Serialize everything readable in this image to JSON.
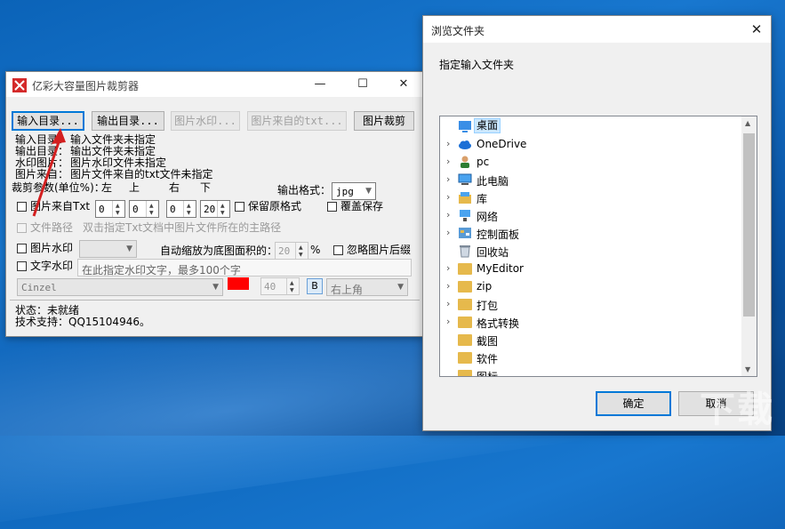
{
  "app": {
    "title": "亿彩大容量图片裁剪器",
    "buttons": {
      "input_dir": "输入目录...",
      "output_dir": "输出目录...",
      "watermark_img": "图片水印...",
      "txt_source": "图片来自的txt...",
      "crop": "图片裁剪"
    },
    "info": {
      "input_label": "输入目录：",
      "input_value": "输入文件夹未指定",
      "output_label": "输出目录：",
      "output_value": "输出文件夹未指定",
      "watermark_label": "水印图片：",
      "watermark_value": "图片水印文件未指定",
      "source_label": "图片来自：",
      "source_value": "图片文件来自的txt文件未指定"
    },
    "crop": {
      "params_label": "裁剪参数(单位%)：",
      "left": "左",
      "top": "上",
      "right": "右",
      "bottom": "下",
      "left_value": "0",
      "top_value": "0",
      "right_value": "0",
      "bottom_value": "20"
    },
    "output_format_label": "输出格式：",
    "output_format_value": "jpg",
    "from_txt_label": "图片来自Txt",
    "keep_format_label": "保留原格式",
    "overwrite_label": "覆盖保存",
    "file_path_label": "文件路径",
    "file_path_hint": "双击指定Txt文档中图片文件所在的主路径",
    "img_watermark_label": "图片水印",
    "auto_scale_label": "自动缩放为底图面积的：",
    "auto_scale_value": "20",
    "auto_scale_unit": "%",
    "ignore_after_label": "忽略图片后缀",
    "text_watermark_label": "文字水印",
    "text_watermark_placeholder": "在此指定水印文字，最多100个字",
    "font_value": "Cinzel",
    "font_color": "#ff0000",
    "font_size_value": "40",
    "bold_label": "B",
    "position_value": "右上角",
    "status_label": "状态：",
    "status_value": "未就绪",
    "support_label": "技术支持：",
    "support_value": "QQ15104946。"
  },
  "dialog": {
    "title": "浏览文件夹",
    "prompt": "指定输入文件夹",
    "items": [
      {
        "label": "桌面",
        "icon": "desktop-icon"
      },
      {
        "label": "OneDrive",
        "icon": "cloud-icon"
      },
      {
        "label": "pc",
        "icon": "user-icon"
      },
      {
        "label": "此电脑",
        "icon": "computer-icon"
      },
      {
        "label": "库",
        "icon": "library-icon"
      },
      {
        "label": "网络",
        "icon": "network-icon"
      },
      {
        "label": "控制面板",
        "icon": "control-panel-icon"
      },
      {
        "label": "回收站",
        "icon": "recycle-bin-icon"
      },
      {
        "label": "MyEditor",
        "icon": "folder-icon"
      },
      {
        "label": "zip",
        "icon": "folder-icon"
      },
      {
        "label": "打包",
        "icon": "folder-icon"
      },
      {
        "label": "格式转换",
        "icon": "folder-icon"
      },
      {
        "label": "截图",
        "icon": "folder-icon"
      },
      {
        "label": "软件",
        "icon": "folder-icon"
      },
      {
        "label": "图标",
        "icon": "folder-icon"
      }
    ],
    "ok": "确定",
    "cancel": "取消"
  },
  "watermark": "下载"
}
